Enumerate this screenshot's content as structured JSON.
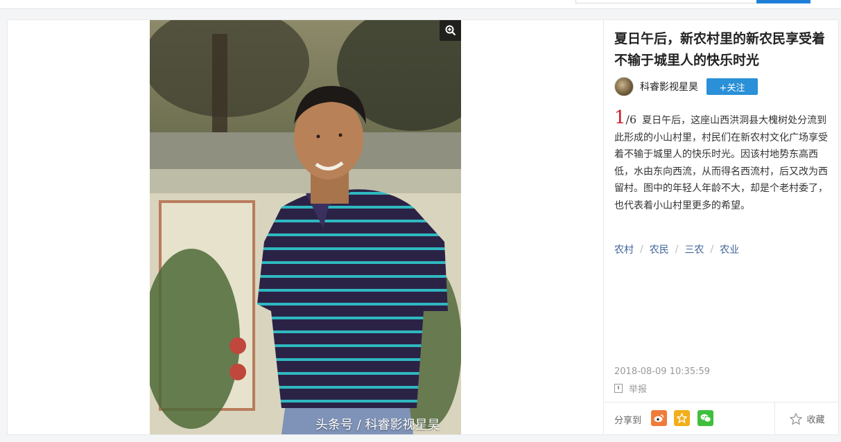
{
  "article": {
    "title": "夏日午后，新农村里的新农民享受着不输于城里人的快乐时光",
    "author": "科睿影视星昊",
    "follow_label": "+关注",
    "index": "1",
    "total": "/6",
    "description": "夏日午后，这座山西洪洞县大槐树处分流到此形成的小山村里，村民们在新农村文化广场享受着不输于城里人的快乐时光。因该村地势东高西低，水由东向西流，从而得名西流村，后又改为西留村。图中的年轻人年龄不大，却是个老村委了，也代表着小山村里更多的希望。",
    "tags": [
      "农村",
      "农民",
      "三农",
      "农业"
    ],
    "date": "2018-08-09 10:35:59",
    "report_label": "举报"
  },
  "photo": {
    "watermark": "头条号 / 科睿影视星昊"
  },
  "share": {
    "label": "分享到",
    "icons": [
      "weibo-icon",
      "qzone-icon",
      "wechat-icon"
    ],
    "favorite_label": "收藏"
  },
  "colors": {
    "accent": "#2a90d7",
    "index_red": "#c91f23",
    "tag_blue": "#406599",
    "weibo": "#ef7c3a",
    "qzone": "#f4ae1a",
    "wechat": "#3fbf3d"
  }
}
